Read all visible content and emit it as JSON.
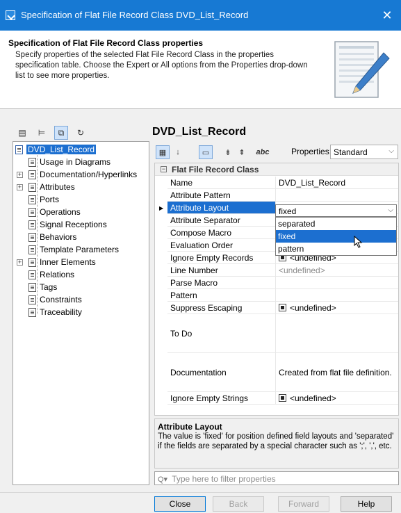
{
  "window": {
    "title": "Specification of Flat File Record Class DVD_List_Record",
    "close_glyph": "✕"
  },
  "header": {
    "title": "Specification of Flat File Record Class properties",
    "description": "Specify properties of the selected Flat File Record Class in the properties specification table. Choose the Expert or All options from the Properties drop-down list to see more properties."
  },
  "tree": {
    "root_label": "DVD_List_Record",
    "items": [
      {
        "label": "Usage in Diagrams",
        "expandable": false
      },
      {
        "label": "Documentation/Hyperlinks",
        "expandable": true
      },
      {
        "label": "Attributes",
        "expandable": true
      },
      {
        "label": "Ports",
        "expandable": false
      },
      {
        "label": "Operations",
        "expandable": false
      },
      {
        "label": "Signal Receptions",
        "expandable": false
      },
      {
        "label": "Behaviors",
        "expandable": false
      },
      {
        "label": "Template Parameters",
        "expandable": false
      },
      {
        "label": "Inner Elements",
        "expandable": true
      },
      {
        "label": "Relations",
        "expandable": false
      },
      {
        "label": "Tags",
        "expandable": false
      },
      {
        "label": "Constraints",
        "expandable": false
      },
      {
        "label": "Traceability",
        "expandable": false
      }
    ]
  },
  "record_title": "DVD_List_Record",
  "properties_toolbar": {
    "label": "Properties:",
    "selected": "Standard"
  },
  "grid": {
    "group_title": "Flat File Record Class",
    "rows": [
      {
        "name": "Name",
        "value": "DVD_List_Record"
      },
      {
        "name": "Attribute Pattern",
        "value": ""
      },
      {
        "name": "Attribute Layout",
        "value": "fixed"
      },
      {
        "name": "Attribute Separator",
        "value": ""
      },
      {
        "name": "Compose Macro",
        "value": ""
      },
      {
        "name": "Evaluation Order",
        "value": ""
      },
      {
        "name": "Ignore Empty Records",
        "value": "<undefined>"
      },
      {
        "name": "Line Number",
        "value": "<undefined>"
      },
      {
        "name": "Parse Macro",
        "value": ""
      },
      {
        "name": "Pattern",
        "value": ""
      },
      {
        "name": "Suppress Escaping",
        "value": "<undefined>"
      },
      {
        "name": "To Do",
        "value": ""
      },
      {
        "name": "Documentation",
        "value": "Created from flat file definition."
      },
      {
        "name": "Ignore Empty Strings",
        "value": "<undefined>"
      }
    ],
    "dropdown_options": [
      "separated",
      "fixed",
      "pattern"
    ],
    "dropdown_highlighted": "fixed"
  },
  "description_box": {
    "title": "Attribute Layout",
    "text": "The value is 'fixed' for position defined field layouts and 'separated' if the fields are separated by a special character such as ';', ',', etc."
  },
  "filter": {
    "placeholder": "Type here to filter properties"
  },
  "buttons": {
    "close": "Close",
    "back": "Back",
    "forward": "Forward",
    "help": "Help"
  },
  "colors": {
    "titlebar": "#1779d3",
    "selection": "#1c6fd0"
  }
}
